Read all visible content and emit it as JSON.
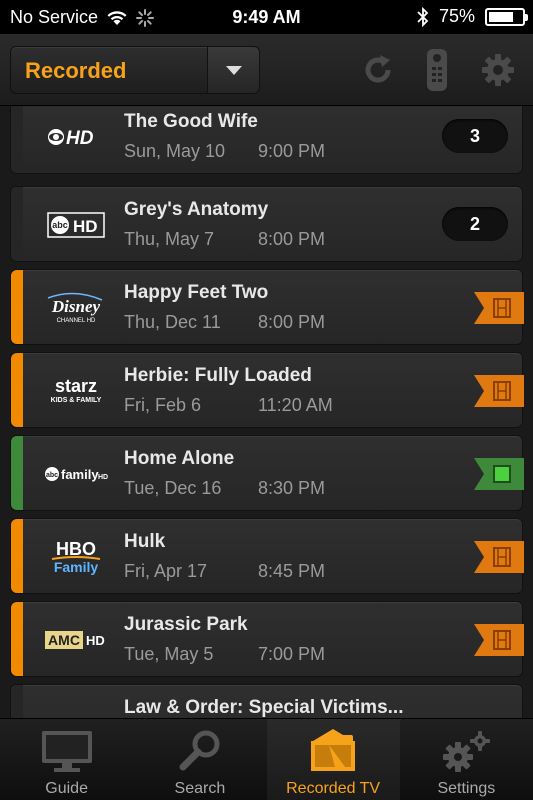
{
  "status_bar": {
    "carrier": "No Service",
    "time": "9:49 AM",
    "battery": "75%",
    "battery_level": 0.75
  },
  "header": {
    "dropdown_label": "Recorded",
    "icons": [
      "refresh-icon",
      "remote-icon",
      "gear-icon"
    ]
  },
  "colors": {
    "accent": "#f7a21b",
    "bar_orange": "#f28a00",
    "bar_green": "#3f8a3a",
    "bar_dark": "#262626"
  },
  "recordings": [
    {
      "channel": "CBS HD",
      "title": "The Good Wife",
      "date": "Sun, May 10",
      "time": "9:00 PM",
      "count": "3",
      "status": "series"
    },
    {
      "channel": "abc HD",
      "title": "Grey's Anatomy",
      "date": "Thu, May 7",
      "time": "8:00 PM",
      "count": "2",
      "status": "series"
    },
    {
      "channel": "Disney Channel HD",
      "title": "Happy Feet Two",
      "date": "Thu, Dec 11",
      "time": "8:00 PM",
      "status": "movie"
    },
    {
      "channel": "starz KIDS & FAMILY",
      "title": "Herbie: Fully Loaded",
      "date": "Fri, Feb 6",
      "time": "11:20 AM",
      "status": "movie"
    },
    {
      "channel": "abc family HD",
      "title": "Home Alone",
      "date": "Tue, Dec 16",
      "time": "8:30 PM",
      "status": "movie-new"
    },
    {
      "channel": "HBO Family",
      "title": "Hulk",
      "date": "Fri, Apr 17",
      "time": "8:45 PM",
      "status": "movie"
    },
    {
      "channel": "AMC HD",
      "title": "Jurassic Park",
      "date": "Tue, May 5",
      "time": "7:00 PM",
      "status": "movie"
    },
    {
      "channel": "",
      "title": "Law & Order: Special Victims...",
      "date": "",
      "time": "",
      "count": "",
      "status": "series"
    }
  ],
  "logos": {
    "cbs": "HD",
    "abc": "abc",
    "abc_hd": "HD",
    "disney": "Disney",
    "disney_sub": "CHANNEL HD",
    "starz": "starz",
    "starz_sub": "KIDS & FAMILY",
    "abcfam_abc": "abc",
    "abcfam_family": "family",
    "abcfam_hd": "HD",
    "hbo": "HBO",
    "hbo_family": "Family",
    "amc": "AMC",
    "amc_hd": "HD"
  },
  "tabs": [
    {
      "label": "Guide",
      "icon": "tv-icon",
      "active": false
    },
    {
      "label": "Search",
      "icon": "magnifier-icon",
      "active": false
    },
    {
      "label": "Recorded TV",
      "icon": "recorded-tv-icon",
      "active": true
    },
    {
      "label": "Settings",
      "icon": "gears-icon",
      "active": false
    }
  ]
}
